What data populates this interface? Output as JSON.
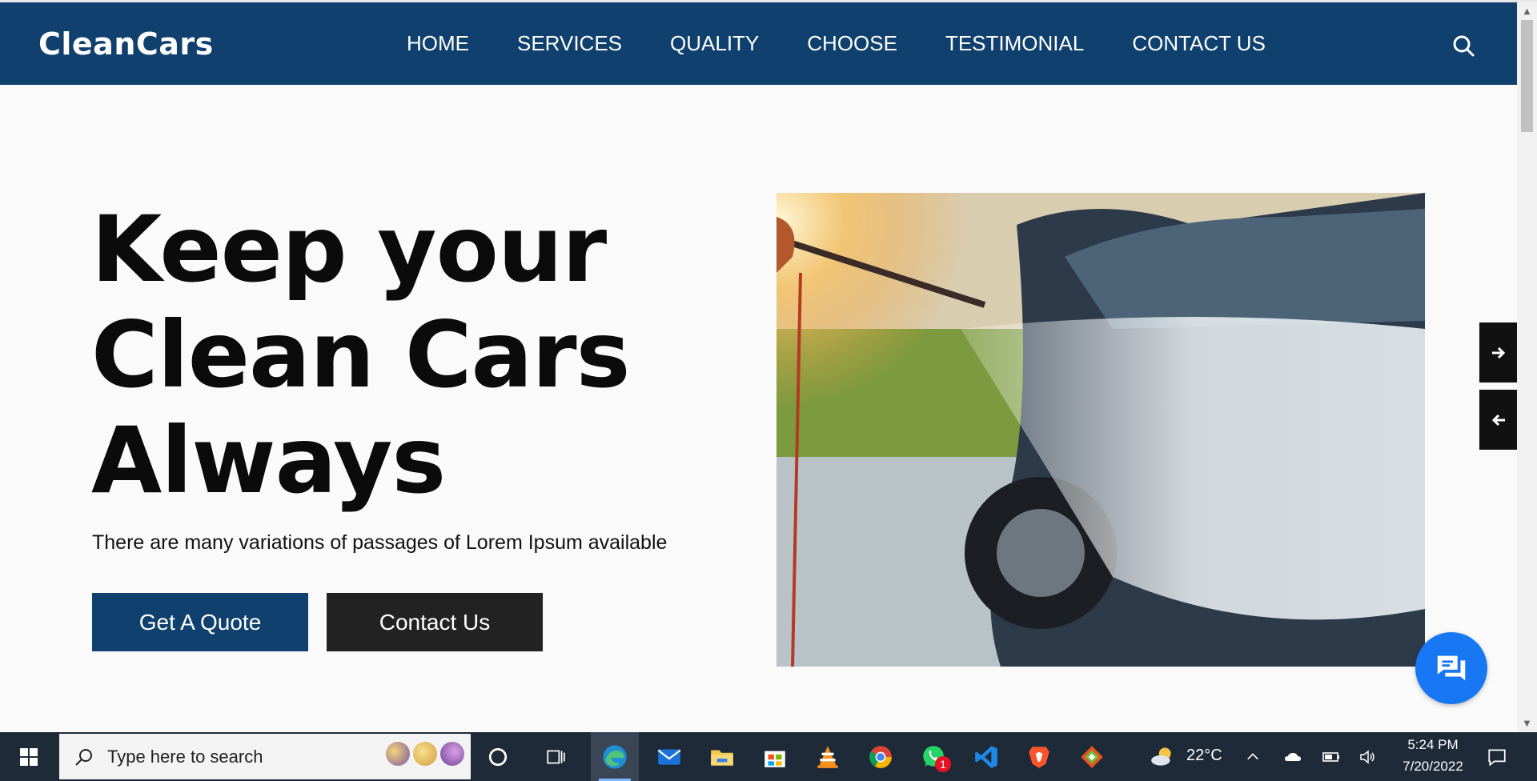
{
  "navbar": {
    "brand": "CleanCars",
    "links": [
      "HOME",
      "SERVICES",
      "QUALITY",
      "CHOOSE",
      "TESTIMONIAL",
      "CONTACT US"
    ]
  },
  "hero": {
    "title_lines": [
      "Keep your",
      "Clean Cars",
      "Always"
    ],
    "subtitle": "There are many variations of passages of Lorem Ipsum available",
    "quote_button": "Get A Quote",
    "contact_button": "Contact Us"
  },
  "icons": {
    "search": "search-icon",
    "next": "arrow-right-icon",
    "prev": "arrow-left-icon",
    "chat": "chat-icon"
  },
  "colors": {
    "brand_navy": "#0f406e",
    "button_dark": "#222222",
    "chat_blue": "#1877f2"
  },
  "taskbar": {
    "search_placeholder": "Type here to search",
    "weather": "22°C",
    "time": "5:24 PM",
    "date": "7/20/2022",
    "whatsapp_badge": "1"
  }
}
